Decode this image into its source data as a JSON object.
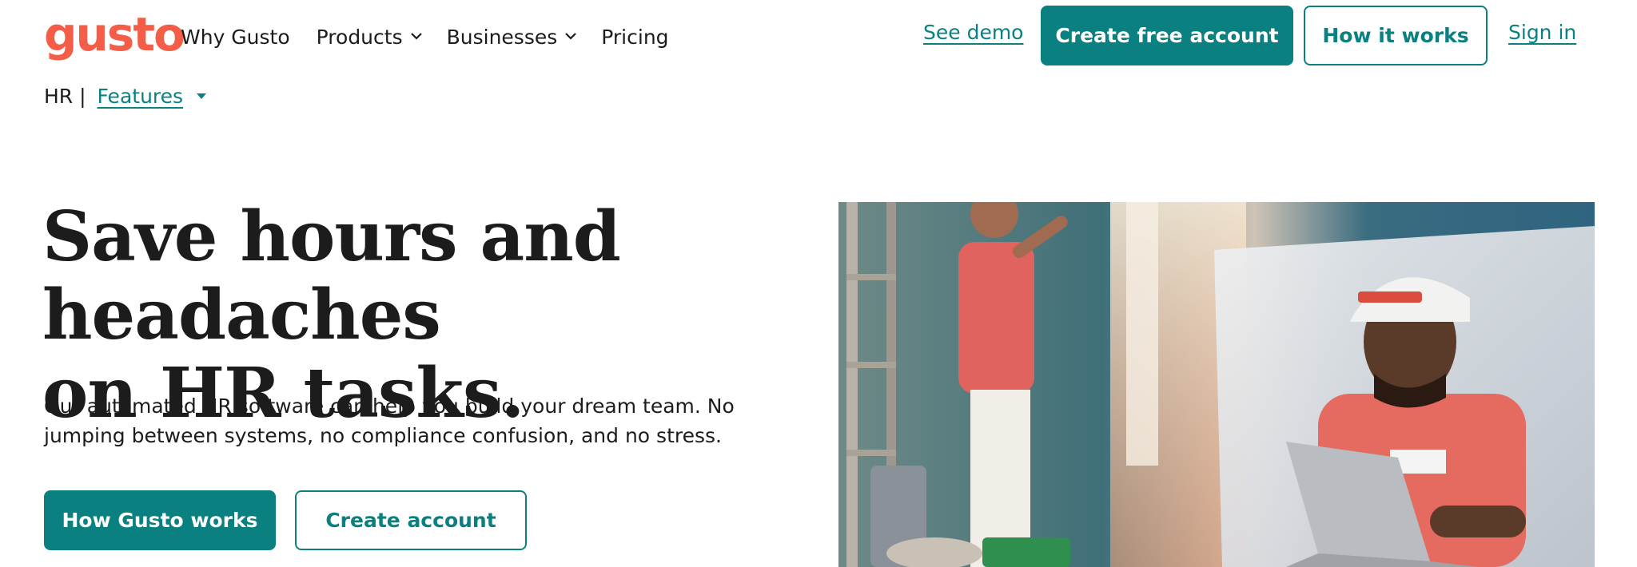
{
  "colors": {
    "brand_coral": "#f45d48",
    "accent_teal": "#0a8080",
    "text_dark": "#1c1c1c"
  },
  "nav": {
    "logo_text": "gusto",
    "links": [
      {
        "label": "Why Gusto",
        "has_dropdown": false
      },
      {
        "label": "Products",
        "has_dropdown": true,
        "icon": "chevron-down-icon"
      },
      {
        "label": "Businesses",
        "has_dropdown": true,
        "icon": "chevron-down-icon"
      },
      {
        "label": "Pricing",
        "has_dropdown": false
      }
    ],
    "see_demo": "See demo",
    "create_free_account": "Create free account",
    "how_it_works": "How it works",
    "sign_in": "Sign in"
  },
  "subnav": {
    "section": "HR |",
    "features": "Features",
    "icon": "caret-down-icon"
  },
  "hero": {
    "title_line1": "Save hours and headaches",
    "title_line2": "on HR tasks.",
    "subtitle_line1": "Our automated HR software can help you build your dream team. No",
    "subtitle_line2": "jumping between systems, no compliance confusion, and no stress.",
    "primary_button": "How Gusto works",
    "secondary_button": "Create account",
    "image": "photo of a worker in a red t-shirt and cap using a laptop while a painter works in the background"
  }
}
